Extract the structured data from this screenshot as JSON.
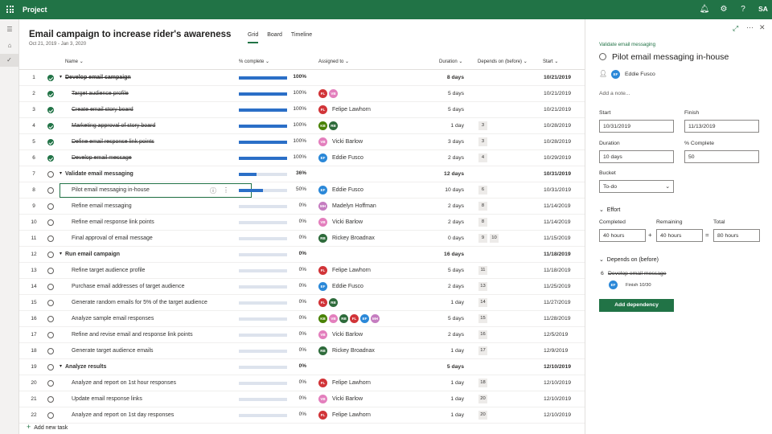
{
  "app": {
    "name": "Project",
    "user_initials": "SA"
  },
  "project": {
    "title": "Email campaign to increase rider's awareness",
    "dates": "Oct 21, 2019 - Jan 3, 2020"
  },
  "tabs": [
    "Grid",
    "Board",
    "Timeline"
  ],
  "columns": {
    "name": "Name",
    "pct": "% complete",
    "assigned": "Assigned to",
    "duration": "Duration",
    "depends": "Depends on (before)",
    "start": "Start"
  },
  "colors": {
    "accent": "#217346",
    "progress": "#2b6fc7"
  },
  "people": {
    "FL": {
      "name": "Felipe Lawhorn",
      "color": "#d13438"
    },
    "VB": {
      "name": "Vicki Barlow",
      "color": "#e37fbd"
    },
    "KB": {
      "name": "",
      "color": "#498205"
    },
    "RB": {
      "name": "Rickey Broadnax",
      "color": "#2e6b3b"
    },
    "EF": {
      "name": "Eddie Fusco",
      "color": "#2b88d8"
    },
    "MH": {
      "name": "Madelyn Hoffman",
      "color": "#c57cc0"
    }
  },
  "rows": [
    {
      "n": "1",
      "name": "Develop email campaign",
      "summary": true,
      "done": true,
      "pct": 100,
      "pct_label": "100%",
      "assigned": [],
      "assignee_name": "",
      "duration": "8 days",
      "deps": [],
      "start": "10/21/2019"
    },
    {
      "n": "2",
      "name": "Target audience profile",
      "summary": false,
      "done": true,
      "pct": 100,
      "pct_label": "100%",
      "assigned": [
        "FL",
        "VB"
      ],
      "assignee_name": "",
      "duration": "5 days",
      "deps": [],
      "start": "10/21/2019"
    },
    {
      "n": "3",
      "name": "Create email story board",
      "summary": false,
      "done": true,
      "pct": 100,
      "pct_label": "100%",
      "assigned": [
        "FL"
      ],
      "assignee_name": "Felipe Lawhorn",
      "duration": "5 days",
      "deps": [],
      "start": "10/21/2019"
    },
    {
      "n": "4",
      "name": "Marketing approval of story board",
      "summary": false,
      "done": true,
      "pct": 100,
      "pct_label": "100%",
      "assigned": [
        "KB",
        "RB"
      ],
      "assignee_name": "",
      "duration": "1 day",
      "deps": [
        "3"
      ],
      "start": "10/28/2019"
    },
    {
      "n": "5",
      "name": "Define email response link points",
      "summary": false,
      "done": true,
      "pct": 100,
      "pct_label": "100%",
      "assigned": [
        "VB"
      ],
      "assignee_name": "Vicki Barlow",
      "duration": "3 days",
      "deps": [
        "3"
      ],
      "start": "10/28/2019"
    },
    {
      "n": "6",
      "name": "Develop email message",
      "summary": false,
      "done": true,
      "pct": 100,
      "pct_label": "100%",
      "assigned": [
        "EF"
      ],
      "assignee_name": "Eddie Fusco",
      "duration": "2 days",
      "deps": [
        "4"
      ],
      "start": "10/29/2019"
    },
    {
      "n": "7",
      "name": "Validate email messaging",
      "summary": true,
      "done": false,
      "pct": 36,
      "pct_label": "36%",
      "assigned": [],
      "assignee_name": "",
      "duration": "12 days",
      "deps": [],
      "start": "10/31/2019"
    },
    {
      "n": "8",
      "name": "Pilot email messaging in-house",
      "summary": false,
      "done": false,
      "pct": 50,
      "pct_label": "50%",
      "assigned": [
        "EF"
      ],
      "assignee_name": "Eddie Fusco",
      "duration": "10 days",
      "deps": [
        "6"
      ],
      "start": "10/31/2019",
      "selected": true
    },
    {
      "n": "9",
      "name": "Refine email messaging",
      "summary": false,
      "done": false,
      "pct": 0,
      "pct_label": "0%",
      "assigned": [
        "MH"
      ],
      "assignee_name": "Madelyn Hoffman",
      "duration": "2 days",
      "deps": [
        "8"
      ],
      "start": "11/14/2019"
    },
    {
      "n": "10",
      "name": "Refine email response link points",
      "summary": false,
      "done": false,
      "pct": 0,
      "pct_label": "0%",
      "assigned": [
        "VB"
      ],
      "assignee_name": "Vicki Barlow",
      "duration": "2 days",
      "deps": [
        "8"
      ],
      "start": "11/14/2019"
    },
    {
      "n": "11",
      "name": "Final approval of email message",
      "summary": false,
      "done": false,
      "pct": 0,
      "pct_label": "0%",
      "assigned": [
        "RB"
      ],
      "assignee_name": "Rickey Broadnax",
      "duration": "0 days",
      "deps": [
        "9",
        "10"
      ],
      "start": "11/15/2019"
    },
    {
      "n": "12",
      "name": "Run email campaign",
      "summary": true,
      "done": false,
      "pct": 0,
      "pct_label": "0%",
      "assigned": [],
      "assignee_name": "",
      "duration": "16 days",
      "deps": [],
      "start": "11/18/2019"
    },
    {
      "n": "13",
      "name": "Refine target audience profile",
      "summary": false,
      "done": false,
      "pct": 0,
      "pct_label": "0%",
      "assigned": [
        "FL"
      ],
      "assignee_name": "Felipe Lawhorn",
      "duration": "5 days",
      "deps": [
        "11"
      ],
      "start": "11/18/2019"
    },
    {
      "n": "14",
      "name": "Purchase email addresses of target audience",
      "summary": false,
      "done": false,
      "pct": 0,
      "pct_label": "0%",
      "assigned": [
        "EF"
      ],
      "assignee_name": "Eddie Fusco",
      "duration": "2 days",
      "deps": [
        "13"
      ],
      "start": "11/25/2019"
    },
    {
      "n": "15",
      "name": "Generate random emails for 5% of the target audience",
      "summary": false,
      "done": false,
      "pct": 0,
      "pct_label": "0%",
      "assigned": [
        "FL",
        "RB"
      ],
      "assignee_name": "",
      "duration": "1 day",
      "deps": [
        "14"
      ],
      "start": "11/27/2019"
    },
    {
      "n": "16",
      "name": "Analyze sample email responses",
      "summary": false,
      "done": false,
      "pct": 0,
      "pct_label": "0%",
      "assigned": [
        "KB",
        "VB",
        "RB",
        "FL",
        "EF",
        "MH"
      ],
      "assignee_name": "",
      "duration": "5 days",
      "deps": [
        "15"
      ],
      "start": "11/28/2019"
    },
    {
      "n": "17",
      "name": "Refine and revise email and response link points",
      "summary": false,
      "done": false,
      "pct": 0,
      "pct_label": "0%",
      "assigned": [
        "VB"
      ],
      "assignee_name": "Vicki Barlow",
      "duration": "2 days",
      "deps": [
        "16"
      ],
      "start": "12/5/2019"
    },
    {
      "n": "18",
      "name": "Generate target audience emails",
      "summary": false,
      "done": false,
      "pct": 0,
      "pct_label": "0%",
      "assigned": [
        "RB"
      ],
      "assignee_name": "Rickey Broadnax",
      "duration": "1 day",
      "deps": [
        "17"
      ],
      "start": "12/9/2019"
    },
    {
      "n": "19",
      "name": "Analyze results",
      "summary": true,
      "done": false,
      "pct": 0,
      "pct_label": "0%",
      "assigned": [],
      "assignee_name": "",
      "duration": "5 days",
      "deps": [],
      "start": "12/10/2019"
    },
    {
      "n": "20",
      "name": "Analyze and report on 1st hour responses",
      "summary": false,
      "done": false,
      "pct": 0,
      "pct_label": "0%",
      "assigned": [
        "FL"
      ],
      "assignee_name": "Felipe Lawhorn",
      "duration": "1 day",
      "deps": [
        "18"
      ],
      "start": "12/10/2019"
    },
    {
      "n": "21",
      "name": "Update email response links",
      "summary": false,
      "done": false,
      "pct": 0,
      "pct_label": "0%",
      "assigned": [
        "VB"
      ],
      "assignee_name": "Vicki Barlow",
      "duration": "1 day",
      "deps": [
        "20"
      ],
      "start": "12/10/2019"
    },
    {
      "n": "22",
      "name": "Analyze and report on 1st day responses",
      "summary": false,
      "done": false,
      "pct": 0,
      "pct_label": "0%",
      "assigned": [
        "FL"
      ],
      "assignee_name": "Felipe Lawhorn",
      "duration": "1 day",
      "deps": [
        "20"
      ],
      "start": "12/10/2019"
    }
  ],
  "add_task": "Add new task",
  "panel": {
    "breadcrumb": "Validate email messaging",
    "title": "Pilot email messaging in-house",
    "assignee_initials": "EF",
    "assignee": "Eddie Fusco",
    "note_placeholder": "Add a note...",
    "start_label": "Start",
    "start_value": "10/31/2019",
    "finish_label": "Finish",
    "finish_value": "11/13/2019",
    "duration_label": "Duration",
    "duration_value": "10 days",
    "pct_label": "% Complete",
    "pct_value": "50",
    "bucket_label": "Bucket",
    "bucket_value": "To-do",
    "effort_label": "Effort",
    "completed_label": "Completed",
    "completed_value": "40 hours",
    "remaining_label": "Remaining",
    "remaining_value": "40 hours",
    "total_label": "Total",
    "total_value": "80 hours",
    "plus": "+",
    "equals": "=",
    "depends_label": "Depends on (before)",
    "dep_number": "6",
    "dep_name": "Develop email message",
    "dep_initials": "EF",
    "dep_finish": "Finish 10/30",
    "add_dependency": "Add dependency"
  }
}
